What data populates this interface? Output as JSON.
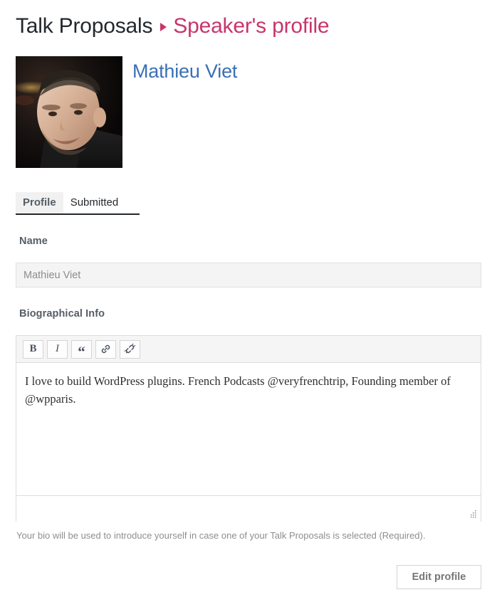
{
  "breadcrumb": {
    "root_label": "Talk Proposals",
    "separator_icon": "triangle-right-icon",
    "current_label": "Speaker's profile",
    "root_color": "#23282d",
    "current_color": "#c9346b"
  },
  "profile": {
    "avatar_icon": "user-avatar-photo",
    "display_name": "Mathieu Viet",
    "name_color": "#3a6fb5"
  },
  "tabs": [
    {
      "label": "Profile",
      "active": true
    },
    {
      "label": "Submitted",
      "active": false
    }
  ],
  "form": {
    "name_field": {
      "label": "Name",
      "value": "Mathieu Viet",
      "placeholder": "Name",
      "readonly": true
    },
    "bio_field": {
      "label": "Biographical Info",
      "value": "I love to build WordPress plugins. French Podcasts @veryfrenchtrip, Founding member of @wpparis.",
      "placeholder": "Biographical Info",
      "help_text": "Your bio will be used to introduce yourself in case one of your Talk Proposals is selected (Required).",
      "toolbar": [
        {
          "name": "bold-icon",
          "glyph": "B",
          "title": "Bold"
        },
        {
          "name": "italic-icon",
          "glyph": "I",
          "title": "Italic"
        },
        {
          "name": "blockquote-icon",
          "glyph": "“",
          "title": "Blockquote"
        },
        {
          "name": "link-icon",
          "glyph": "",
          "title": "Insert link"
        },
        {
          "name": "unlink-icon",
          "glyph": "",
          "title": "Remove link"
        }
      ],
      "resize_handle_icon": "resize-grip-icon"
    }
  },
  "actions": {
    "edit_profile_label": "Edit profile"
  }
}
